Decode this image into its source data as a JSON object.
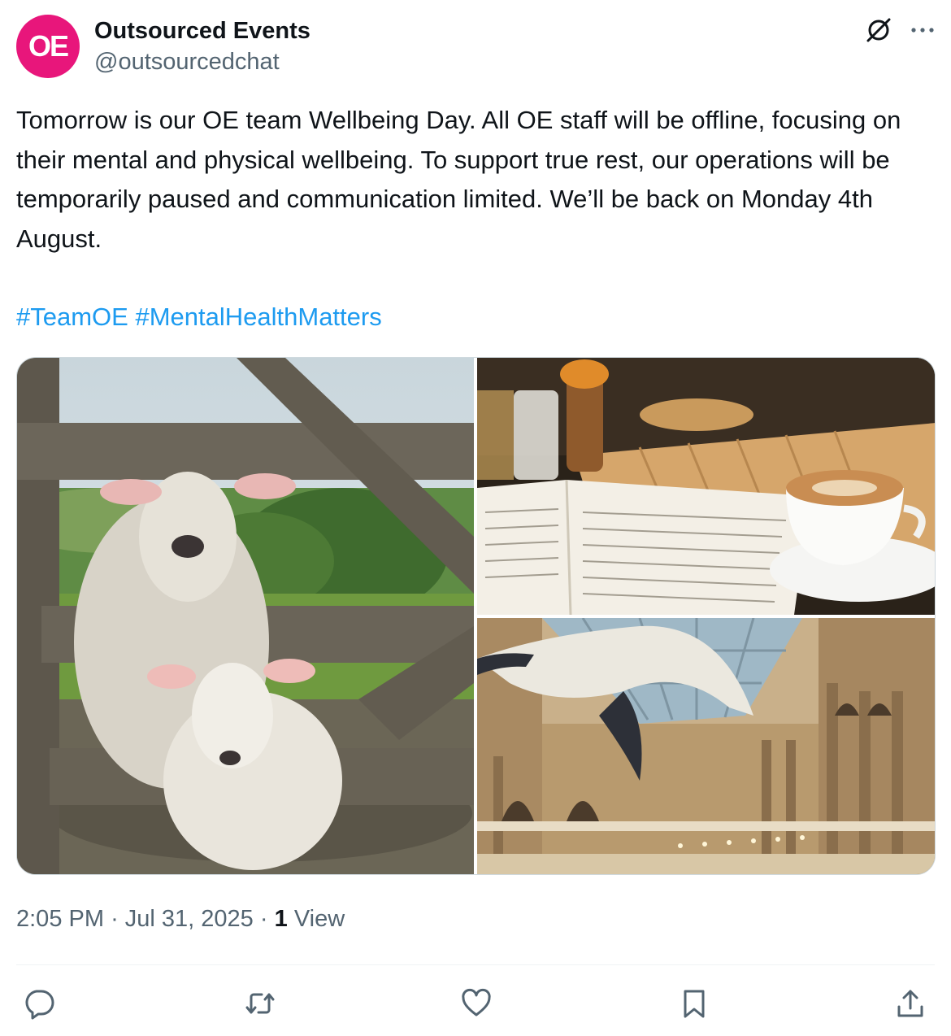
{
  "author": {
    "avatar_text": "OE",
    "display_name": "Outsourced Events",
    "handle": "@outsourcedchat",
    "brand_color": "#e8167b"
  },
  "post": {
    "text": "Tomorrow is our OE team Wellbeing Day. All OE staff will be offline, focusing on their mental and physical wellbeing. To support true rest, our operations will be temporarily paused and communication limited. We’ll be back on Monday 4th August.",
    "hashtags": [
      "#TeamOE",
      "#MentalHealthMatters"
    ],
    "hashtag_color": "#1d9bf0"
  },
  "media": {
    "photos": [
      "sheep-photo",
      "coffee-book-photo",
      "whale-atrium-photo"
    ]
  },
  "meta": {
    "time": "2:05 PM",
    "date": "Jul 31, 2025",
    "separator": "·",
    "views_count": "1",
    "views_label": "View"
  },
  "actions": {
    "icons": [
      "reply-icon",
      "repost-icon",
      "like-icon",
      "bookmark-icon",
      "share-icon"
    ]
  },
  "top_icons": [
    "grok-icon",
    "more-icon"
  ]
}
